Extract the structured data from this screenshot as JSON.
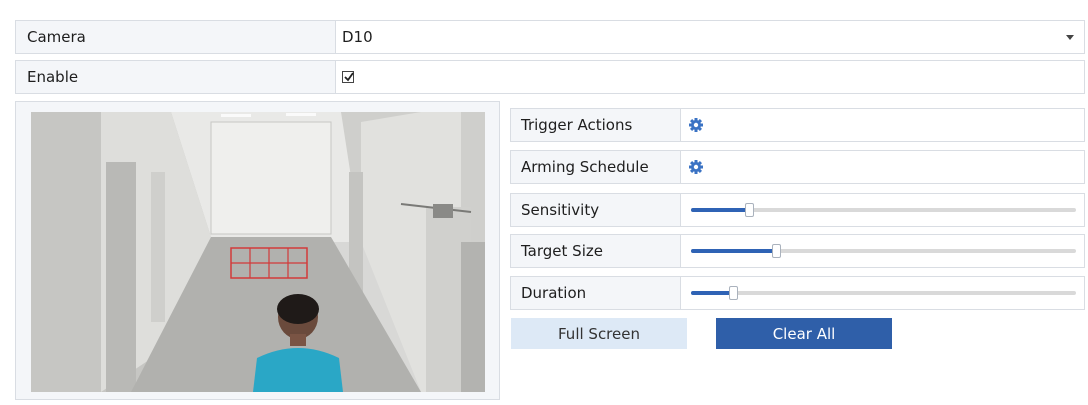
{
  "camera": {
    "label": "Camera",
    "value": "D10"
  },
  "enable": {
    "label": "Enable",
    "checked": true
  },
  "settings": {
    "trigger_actions": {
      "label": "Trigger Actions",
      "icon": "gear-icon"
    },
    "arming_schedule": {
      "label": "Arming Schedule",
      "icon": "gear-icon"
    },
    "sensitivity": {
      "label": "Sensitivity",
      "level_fraction": 0.15
    },
    "target_size": {
      "label": "Target Size",
      "level_fraction": 0.22
    },
    "duration": {
      "label": "Duration",
      "level_fraction": 0.11
    }
  },
  "buttons": {
    "full_screen": "Full Screen",
    "clear_all": "Clear All"
  },
  "colors": {
    "accent": "#2f5fa9",
    "detection_grid": "#d23a3a",
    "label_bg": "#f4f6f9"
  }
}
